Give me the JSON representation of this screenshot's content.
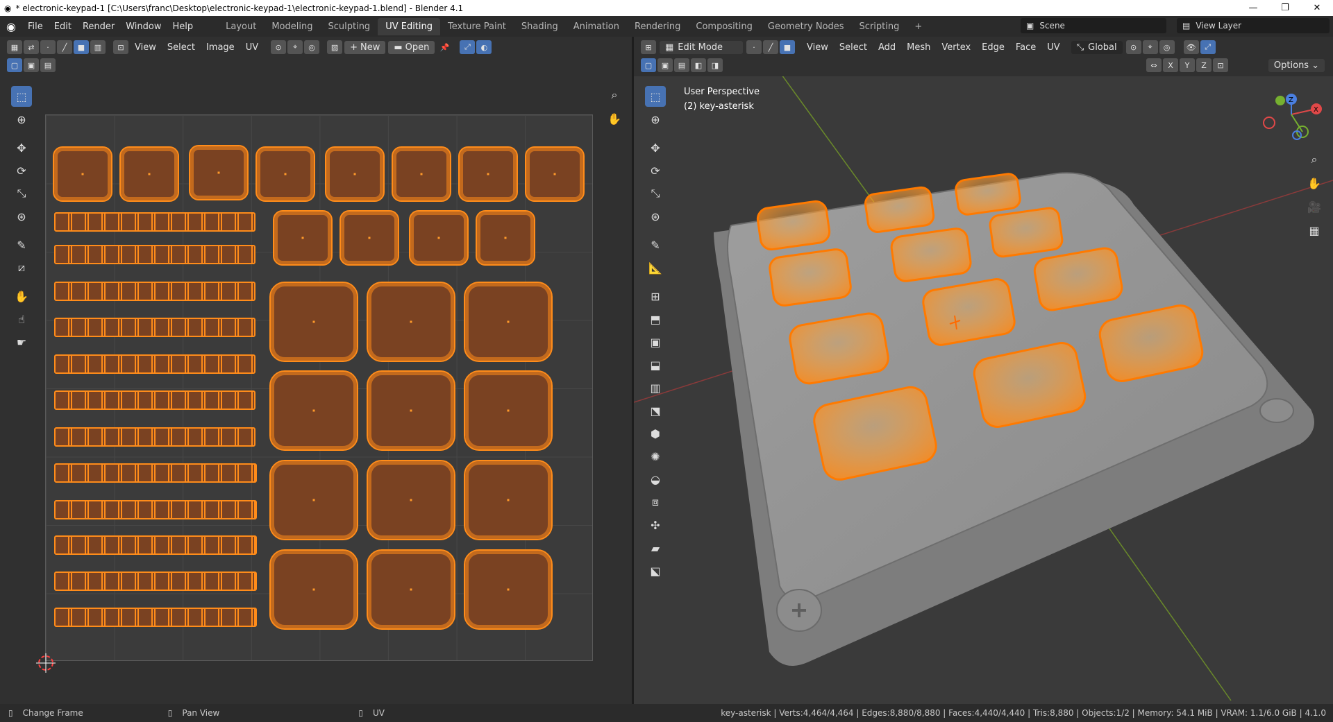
{
  "window": {
    "title": "* electronic-keypad-1 [C:\\Users\\franc\\Desktop\\electronic-keypad-1\\electronic-keypad-1.blend] - Blender 4.1",
    "controls": [
      "—",
      "❐",
      "✕"
    ]
  },
  "menu": {
    "items": [
      "File",
      "Edit",
      "Render",
      "Window",
      "Help"
    ]
  },
  "workspaces": {
    "tabs": [
      "Layout",
      "Modeling",
      "Sculpting",
      "UV Editing",
      "Texture Paint",
      "Shading",
      "Animation",
      "Rendering",
      "Compositing",
      "Geometry Nodes",
      "Scripting"
    ],
    "active": "UV Editing",
    "add": "+"
  },
  "scene": {
    "name": "Scene",
    "view_layer": "View Layer"
  },
  "uv_editor": {
    "header": {
      "view": "View",
      "select": "Select",
      "image": "Image",
      "uv": "UV",
      "new": "New",
      "open": "Open"
    }
  },
  "viewport": {
    "header": {
      "mode": "Edit Mode",
      "view": "View",
      "select": "Select",
      "add": "Add",
      "mesh": "Mesh",
      "vertex": "Vertex",
      "edge": "Edge",
      "face": "Face",
      "uv": "UV",
      "orientation": "Global",
      "options": "Options"
    },
    "axes": {
      "x": "X",
      "y": "Y",
      "z": "Z"
    },
    "overlay": {
      "line1": "User Perspective",
      "line2": "(2) key-asterisk"
    }
  },
  "status": {
    "left1": "Change Frame",
    "left2": "Pan View",
    "left3": "UV",
    "stats": "key-asterisk | Verts:4,464/4,464 | Edges:8,880/8,880 | Faces:4,440/4,440 | Tris:8,880 | Objects:1/2 | Memory: 54.1 MiB | VRAM: 1.1/6.0 GiB | 4.1.0"
  },
  "colors": {
    "accent": "#4772b3",
    "selection": "#ff8c1a",
    "background": "#303030"
  }
}
